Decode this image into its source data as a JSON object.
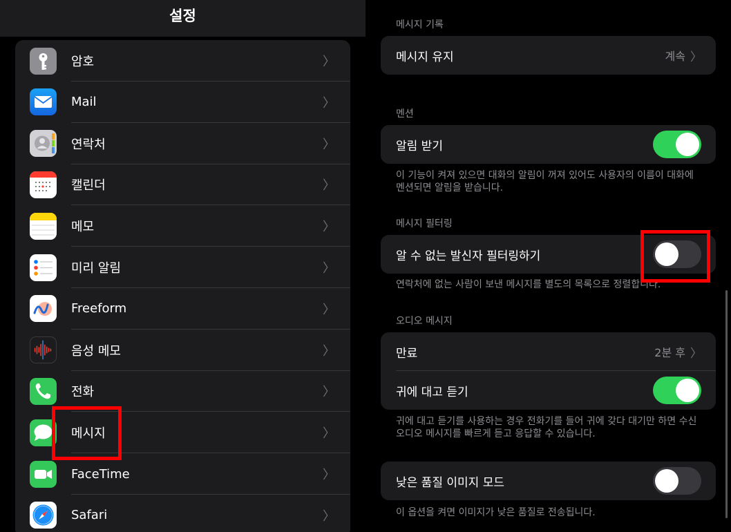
{
  "left": {
    "title": "설정",
    "items": [
      {
        "label": "암호",
        "icon": "key-icon",
        "color": "#8e8e93"
      },
      {
        "label": "Mail",
        "icon": "mail-icon",
        "color": "#1e88e5"
      },
      {
        "label": "연락처",
        "icon": "contacts-icon",
        "color": "#c7c7cc"
      },
      {
        "label": "캘린더",
        "icon": "calendar-icon",
        "color": "#ffffff"
      },
      {
        "label": "메모",
        "icon": "notes-icon",
        "color": "#ffffff"
      },
      {
        "label": "미리 알림",
        "icon": "reminders-icon",
        "color": "#ffffff"
      },
      {
        "label": "Freeform",
        "icon": "freeform-icon",
        "color": "#ffffff"
      },
      {
        "label": "음성 메모",
        "icon": "voice-memo-icon",
        "color": "#1c1c1e"
      },
      {
        "label": "전화",
        "icon": "phone-icon",
        "color": "#34c759"
      },
      {
        "label": "메시지",
        "icon": "messages-icon",
        "color": "#34c759"
      },
      {
        "label": "FaceTime",
        "icon": "facetime-icon",
        "color": "#34c759"
      },
      {
        "label": "Safari",
        "icon": "safari-icon",
        "color": "#ffffff"
      }
    ]
  },
  "right": {
    "history": {
      "header": "메시지 기록",
      "keep_label": "메시지 유지",
      "keep_value": "계속"
    },
    "mentions": {
      "header": "멘션",
      "notify_label": "알림 받기",
      "notify_on": true,
      "footer": "이 기능이 켜져 있으면 대화의 알림이 꺼져 있어도 사용자의 이름이 대화에 멘션되면 알림을 받습니다."
    },
    "filtering": {
      "header": "메시지 필터링",
      "filter_label": "알 수 없는 발신자 필터링하기",
      "filter_on": false,
      "footer": "연락처에 없는 사람이 보낸 메시지를 별도의 목록으로 정렬합니다."
    },
    "audio": {
      "header": "오디오 메시지",
      "expire_label": "만료",
      "expire_value": "2분 후",
      "raise_label": "귀에 대고 듣기",
      "raise_on": true,
      "footer": "귀에 대고 듣기를 사용하는 경우 전화기를 들어 귀에 갖다 대기만 하면 수신 오디오 메시지를 빠르게 듣고 응답할 수 있습니다."
    },
    "lowquality": {
      "label": "낮은 품질 이미지 모드",
      "on": false,
      "footer": "이 옵션을 켜면 이미지가 낮은 품질로 전송됩니다."
    }
  },
  "colors": {
    "toggle_on": "#30d158",
    "highlight": "#ff0000"
  }
}
